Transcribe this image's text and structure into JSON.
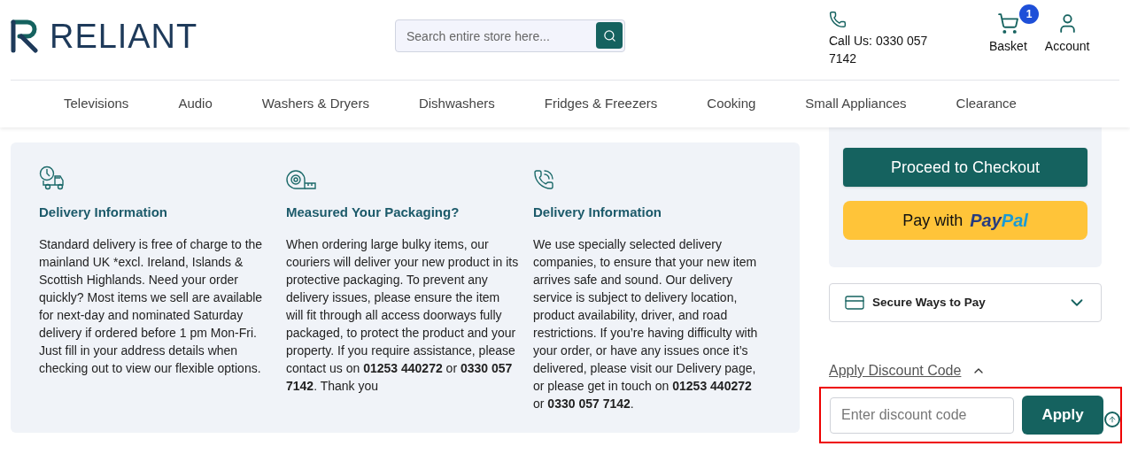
{
  "header": {
    "logo": "RELIANT",
    "search": {
      "placeholder": "Search entire store here..."
    },
    "call_us": "Call Us: 0330 057 7142",
    "basket": {
      "label": "Basket",
      "count": "1"
    },
    "account": {
      "label": "Account"
    }
  },
  "nav": [
    "Televisions",
    "Audio",
    "Washers & Dryers",
    "Dishwashers",
    "Fridges & Freezers",
    "Cooking",
    "Small Appliances",
    "Clearance"
  ],
  "info_columns": [
    {
      "kind": "truck",
      "title": "Delivery Information",
      "text": "Standard delivery is free of charge to the mainland UK *excl. Ireland, Islands & Scottish Highlands. Need your order quickly? Most items we sell are available for next-day and nominated Saturday delivery if ordered before 1 pm Mon-Fri. Just fill in your address details when checking out to view our flexible options."
    },
    {
      "kind": "tape",
      "title": "Measured Your Packaging?",
      "text": "When ordering large bulky items, our couriers will deliver your new product in its protective packaging. To prevent any delivery issues, please ensure the item will fit through all access doorways fully packaged, to protect the product and your property. If you require assistance, please contact us on **01253 440272** or **0330 057 7142**. Thank you"
    },
    {
      "kind": "phone",
      "title": "Delivery Information",
      "text": "We use specially selected delivery companies, to ensure that your new item arrives safe and sound. Our delivery service is subject to delivery location, product availability, driver, and road restrictions. If you’re having difficulty with your order, or have any issues once it’s delivered, please visit our Delivery page, or please get in touch on **01253 440272** or **0330 057 7142**."
    }
  ],
  "checkout": {
    "proceed": "Proceed to Checkout",
    "paypal": {
      "label": "Pay with",
      "brand": [
        "Pay",
        "Pal"
      ]
    }
  },
  "secure_pay": {
    "label": "Secure Ways to Pay",
    "expanded": false
  },
  "discount": {
    "toggle": "Apply Discount Code",
    "expanded": true,
    "highlighted": true,
    "placeholder": "Enter discount code",
    "apply": "Apply"
  }
}
